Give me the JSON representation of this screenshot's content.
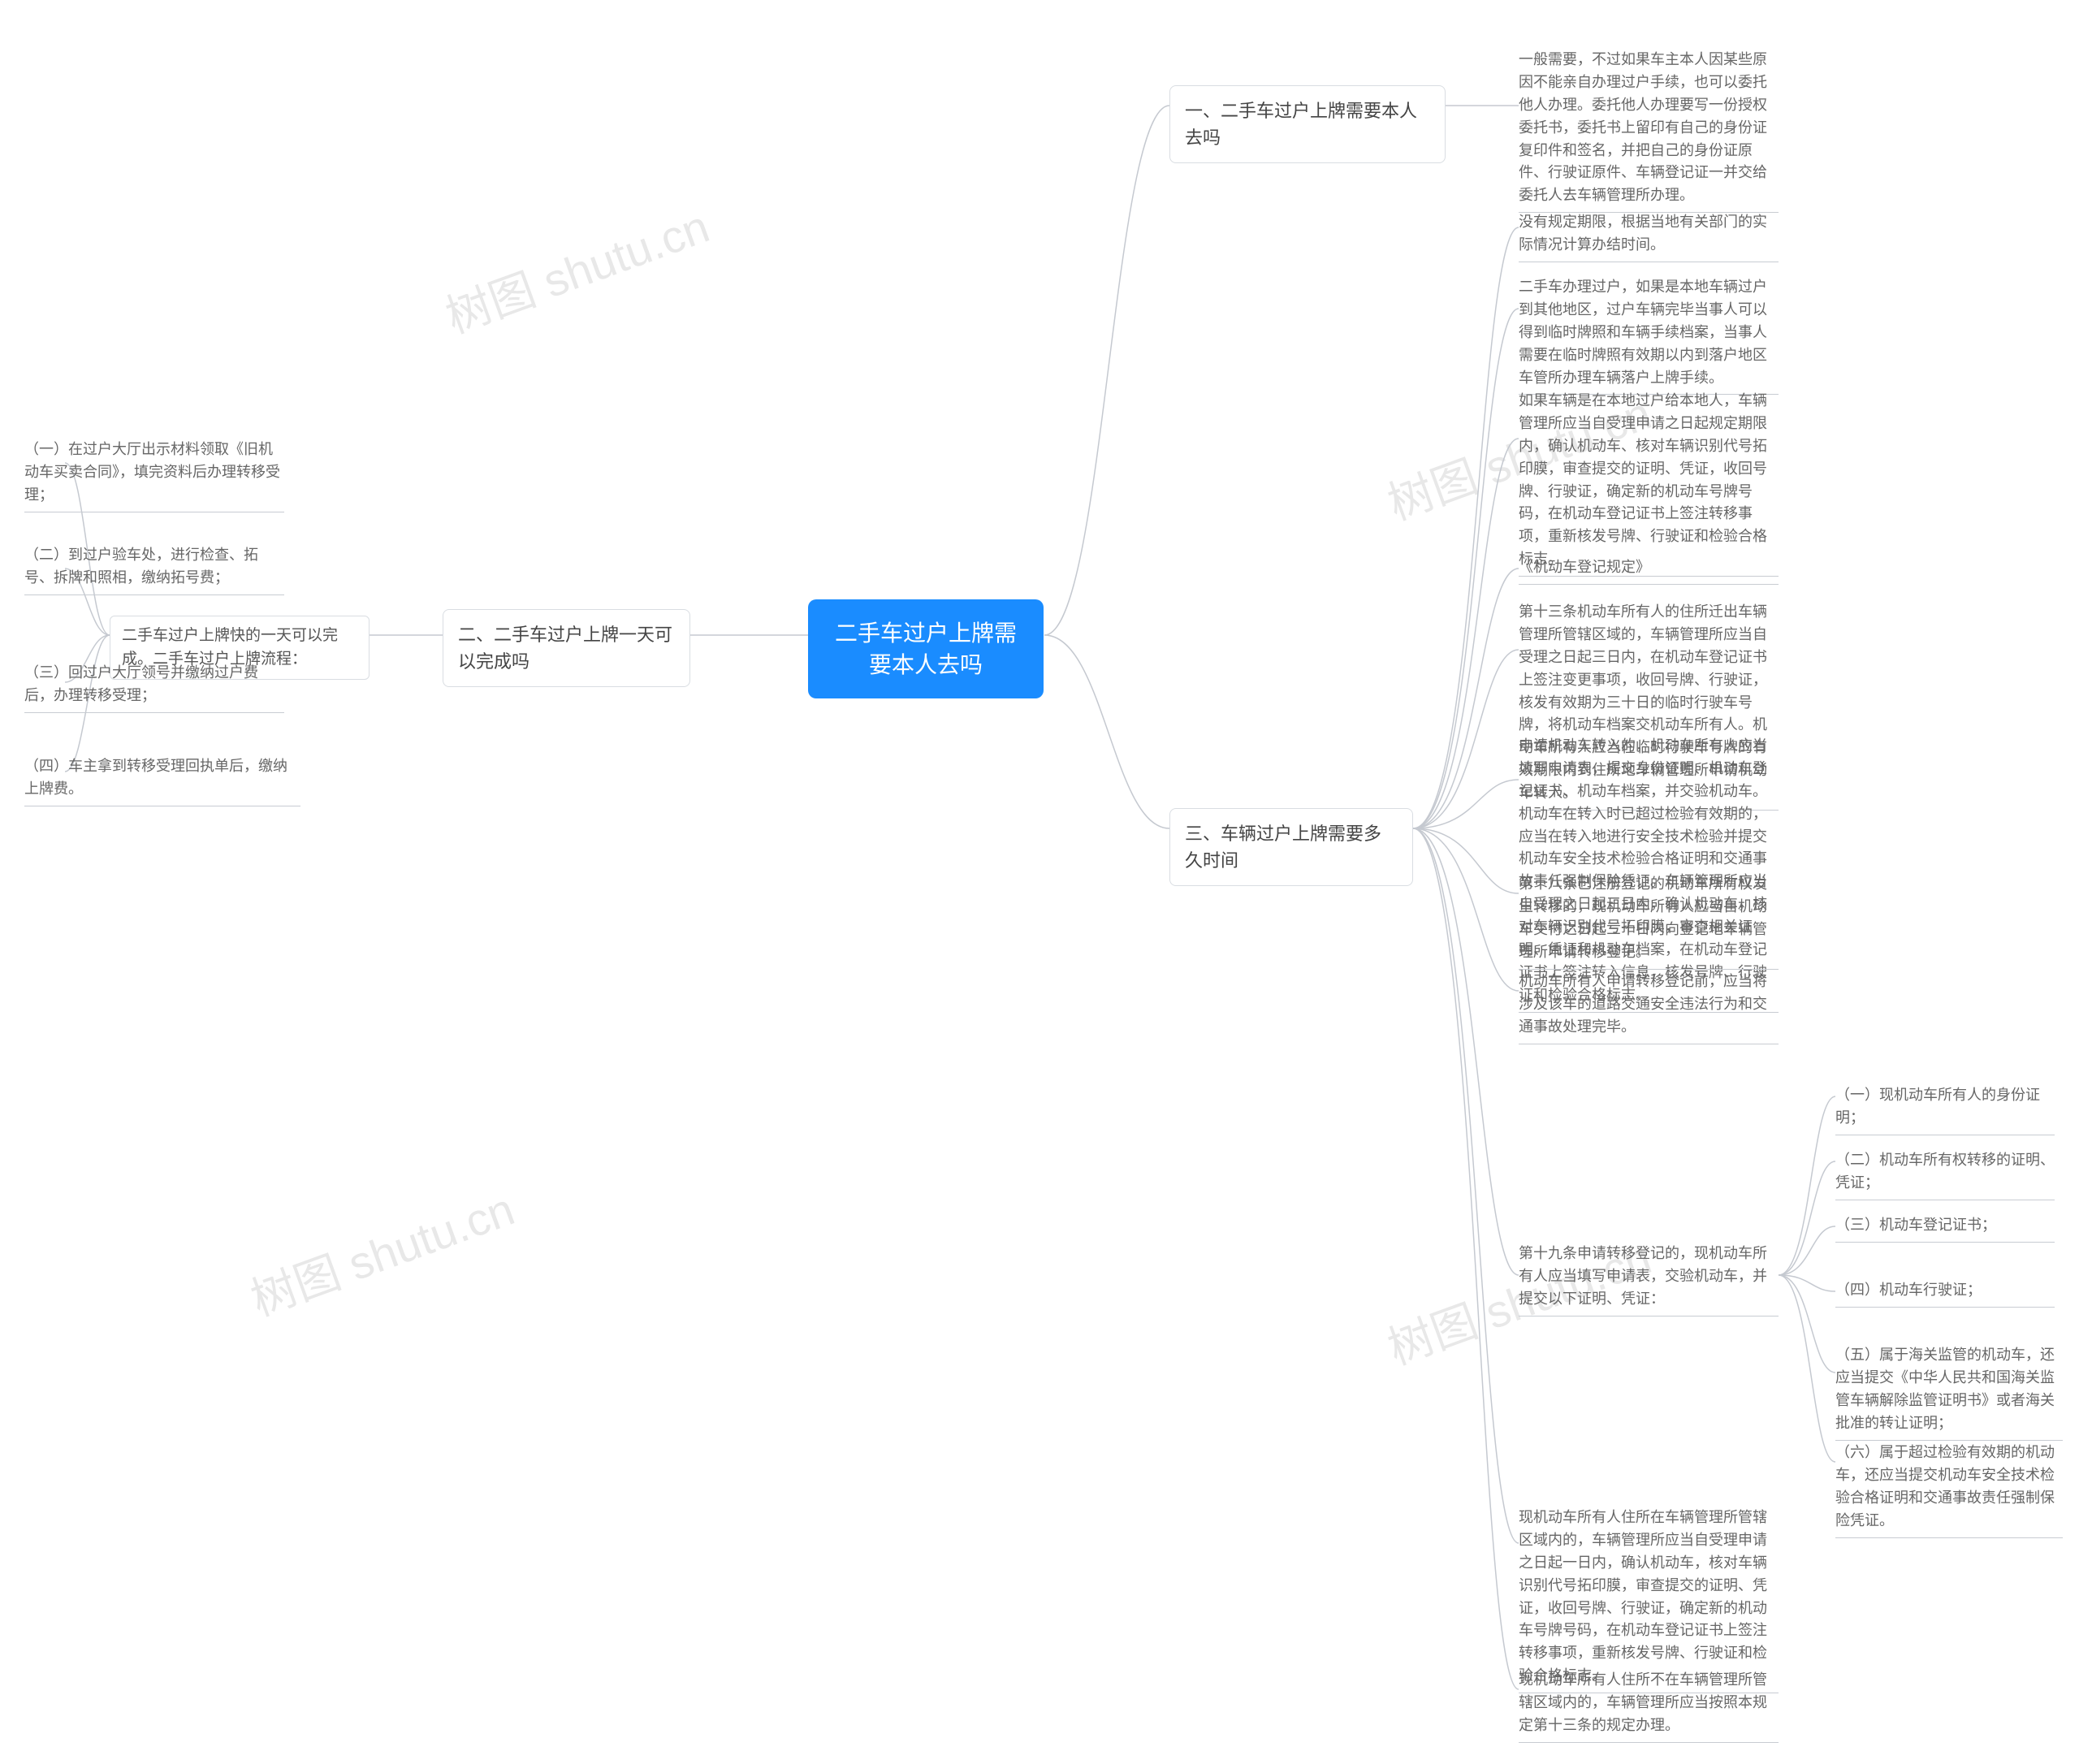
{
  "watermark": "树图 shutu.cn",
  "root": "二手车过户上牌需要本人去吗",
  "branch1": {
    "title": "一、二手车过户上牌需要本人去吗",
    "leaf": "一般需要，不过如果车主本人因某些原因不能亲自办理过户手续，也可以委托他人办理。委托他人办理要写一份授权委托书，委托书上留印有自己的身份证复印件和签名，并把自己的身份证原件、行驶证原件、车辆登记证一并交给委托人去车辆管理所办理。"
  },
  "branch2": {
    "title": "二、二手车过户上牌一天可以完成吗",
    "sub": "二手车过户上牌快的一天可以完成。二手车过户上牌流程：",
    "leaves": [
      "（一）在过户大厅出示材料领取《旧机动车买卖合同》，填完资料后办理转移受理；",
      "（二）到过户验车处，进行检查、拓号、拆牌和照相，缴纳拓号费；",
      "（三）回过户大厅领号并缴纳过户费后，办理转移受理；",
      "（四）车主拿到转移受理回执单后，缴纳上牌费。"
    ]
  },
  "branch3": {
    "title": "三、车辆过户上牌需要多久时间",
    "leaves": [
      "没有规定期限，根据当地有关部门的实际情况计算办结时间。",
      "二手车办理过户，如果是本地车辆过户到其他地区，过户车辆完毕当事人可以得到临时牌照和车辆手续档案，当事人需要在临时牌照有效期以内到落户地区车管所办理车辆落户上牌手续。",
      "如果车辆是在本地过户给本地人，车辆管理所应当自受理申请之日起规定期限内，确认机动车、核对车辆识别代号拓印膜，审查提交的证明、凭证，收回号牌、行驶证，确定新的机动车号牌号码，在机动车登记证书上签注转移事项，重新核发号牌、行驶证和检验合格标志。",
      "《机动车登记规定》",
      "第十三条机动车所有人的住所迁出车辆管理所管辖区域的，车辆管理所应当自受理之日起三日内，在机动车登记证书上签注变更事项，收回号牌、行驶证，核发有效期为三十日的临时行驶车号牌，将机动车档案交机动车所有人。机动车所有人应当在临时行驶车号牌的有效期限内到住所地车辆管理所申请机动车转入。",
      "申请机动车转入的，机动车所有人应当填写申请表，提交身份证明、机动车登记证书、机动车档案，并交验机动车。机动车在转入时已超过检验有效期的，应当在转入地进行安全技术检验并提交机动车安全技术检验合格证明和交通事故责任强制保险凭证。车辆管理所应当自受理之日起三日内，确认机动车，核对车辆识别代号拓印膜，审查相关证明、凭证和机动车档案，在机动车登记证书上签注转入信息，核发号牌、行驶证和检验合格标志。",
      "第十八条已注册登记的机动车所有权发生转移的，现机动车所有人应当自机动车交付之日起三十日内向登记地车辆管理所申请转移登记。",
      "机动车所有人申请转移登记前，应当将涉及该车的道路交通安全违法行为和交通事故处理完毕。"
    ],
    "sub19": "第十九条申请转移登记的，现机动车所有人应当填写申请表，交验机动车，并提交以下证明、凭证：",
    "list19": [
      "（一）现机动车所有人的身份证明；",
      "（二）机动车所有权转移的证明、凭证；",
      "（三）机动车登记证书；",
      "（四）机动车行驶证；",
      "（五）属于海关监管的机动车，还应当提交《中华人民共和国海关监管车辆解除监管证明书》或者海关批准的转让证明；",
      "（六）属于超过检验有效期的机动车，还应当提交机动车安全技术检验合格证明和交通事故责任强制保险凭证。"
    ],
    "tail": [
      "现机动车所有人住所在车辆管理所管辖区域内的，车辆管理所应当自受理申请之日起一日内，确认机动车，核对车辆识别代号拓印膜，审查提交的证明、凭证，收回号牌、行驶证，确定新的机动车号牌号码，在机动车登记证书上签注转移事项，重新核发号牌、行驶证和检验合格标志。",
      "现机动车所有人住所不在车辆管理所管辖区域内的，车辆管理所应当按照本规定第十三条的规定办理。"
    ]
  }
}
